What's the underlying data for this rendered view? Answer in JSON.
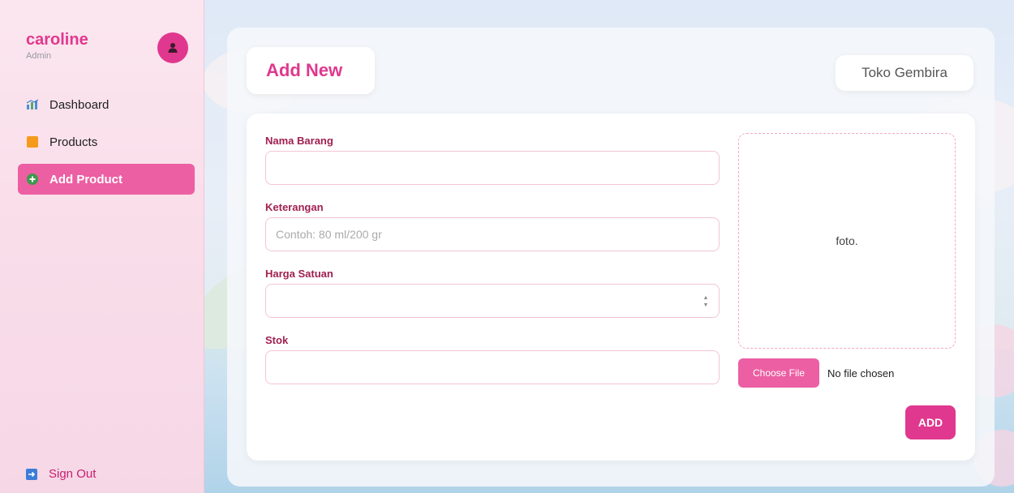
{
  "user": {
    "name": "caroline",
    "role": "Admin"
  },
  "nav": {
    "items": [
      {
        "label": "Dashboard",
        "icon": "chart-icon",
        "active": false
      },
      {
        "label": "Products",
        "icon": "box-icon",
        "active": false
      },
      {
        "label": "Add Product",
        "icon": "plus-circle-icon",
        "active": true
      }
    ],
    "signout_label": "Sign Out"
  },
  "header": {
    "title": "Add New",
    "store_name": "Toko Gembira"
  },
  "form": {
    "nama_barang": {
      "label": "Nama Barang",
      "value": "",
      "placeholder": ""
    },
    "keterangan": {
      "label": "Keterangan",
      "value": "",
      "placeholder": "Contoh: 80 ml/200 gr"
    },
    "harga_satuan": {
      "label": "Harga Satuan",
      "value": "",
      "placeholder": ""
    },
    "stok": {
      "label": "Stok",
      "value": "",
      "placeholder": ""
    },
    "photo_placeholder": "foto.",
    "choose_file_label": "Choose File",
    "file_status": "No file chosen",
    "submit_label": "ADD"
  },
  "colors": {
    "accent": "#e0388e",
    "accent_light": "#ec5fa3",
    "label": "#a0204f"
  }
}
